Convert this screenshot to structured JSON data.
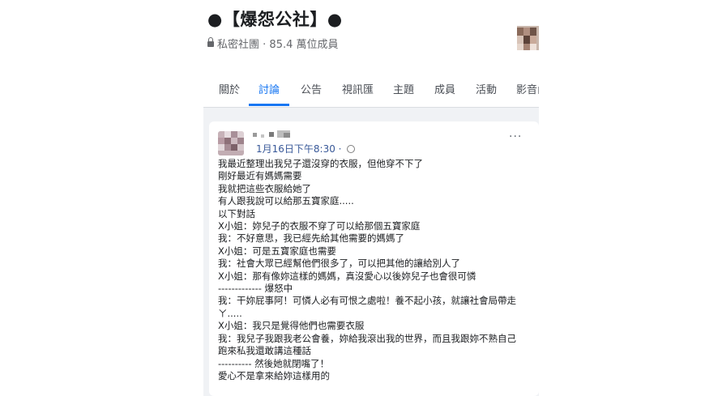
{
  "group": {
    "title": "●【爆怨公社】●",
    "privacy": "私密社團",
    "separator": " · ",
    "members": "85.4 萬位成員"
  },
  "tabs": [
    {
      "label": "關於"
    },
    {
      "label": "討論"
    },
    {
      "label": "公告"
    },
    {
      "label": "視訊匯"
    },
    {
      "label": "主題"
    },
    {
      "label": "成員"
    },
    {
      "label": "活動"
    },
    {
      "label": "影音內"
    }
  ],
  "post": {
    "time": "1月16日下午8:30",
    "separator": " · ",
    "more": "···",
    "lines": [
      "我最近整理出我兒子還沒穿的衣服，但他穿不下了",
      "剛好最近有媽媽需要",
      "我就把這些衣服給她了",
      "有人跟我說可以給那五寶家庭.....",
      "以下對話",
      "X小姐：妳兒子的衣服不穿了可以給那個五寶家庭",
      "我：不好意思，我已經先給其他需要的媽媽了",
      "X小姐：可是五寶家庭也需要",
      "我：社會大眾已經幫他們很多了，可以把其他的讓給別人了",
      "X小姐：那有像妳這樣的媽媽，真沒愛心以後妳兒子也會很可憐",
      "-------------  爆怒中",
      "我：干妳屁事阿！可憐人必有可恨之處啦！養不起小孩，就讓社會局帶走",
      "ㄚ.....",
      "X小姐：我只是覺得他們也需要衣服",
      "我：我兒子我跟我老公會養，妳給我滾出我的世界，而且我跟妳不熟自己",
      "跑來私我還敢講這種話",
      "----------  然後她就閉嘴了！",
      "愛心不是拿來給妳這樣用的"
    ]
  }
}
